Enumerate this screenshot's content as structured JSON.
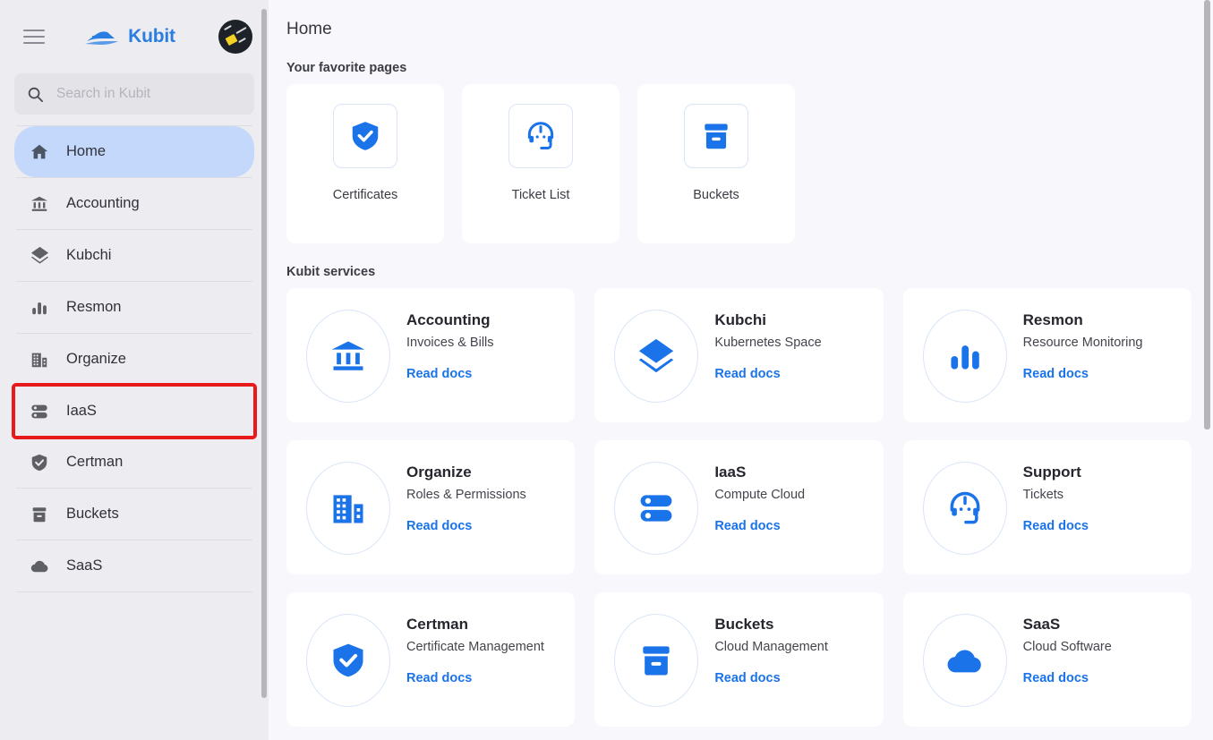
{
  "brand": {
    "name": "Kubit",
    "logo_icon": "speedboat-icon",
    "accent": "#2a7de1"
  },
  "sidebar": {
    "menu_icon": "hamburger-icon",
    "avatar_icon": "user-avatar",
    "search": {
      "placeholder": "Search in Kubit",
      "value": "",
      "icon": "search-icon"
    },
    "items": [
      {
        "label": "Home",
        "icon": "home-icon",
        "active": true,
        "highlighted": false
      },
      {
        "label": "Accounting",
        "icon": "bank-icon",
        "active": false,
        "highlighted": false
      },
      {
        "label": "Kubchi",
        "icon": "layers-icon",
        "active": false,
        "highlighted": false
      },
      {
        "label": "Resmon",
        "icon": "bar-chart-icon",
        "active": false,
        "highlighted": false
      },
      {
        "label": "Organize",
        "icon": "building-icon",
        "active": false,
        "highlighted": false
      },
      {
        "label": "IaaS",
        "icon": "server-icon",
        "active": false,
        "highlighted": true
      },
      {
        "label": "Certman",
        "icon": "shield-check-icon",
        "active": false,
        "highlighted": false
      },
      {
        "label": "Buckets",
        "icon": "archive-icon",
        "active": false,
        "highlighted": false
      },
      {
        "label": "SaaS",
        "icon": "cloud-icon",
        "active": false,
        "highlighted": false
      }
    ],
    "highlight_color": "#e8191b"
  },
  "main": {
    "page_title": "Home",
    "favorites_label": "Your favorite pages",
    "favorites": [
      {
        "name": "Certificates",
        "icon": "shield-check-icon"
      },
      {
        "name": "Ticket List",
        "icon": "headset-icon"
      },
      {
        "name": "Buckets",
        "icon": "archive-icon"
      }
    ],
    "services_label": "Kubit services",
    "read_docs_label": "Read docs",
    "services": [
      {
        "title": "Accounting",
        "subtitle": "Invoices & Bills",
        "icon": "bank-icon"
      },
      {
        "title": "Kubchi",
        "subtitle": "Kubernetes Space",
        "icon": "layers-icon"
      },
      {
        "title": "Resmon",
        "subtitle": "Resource Monitoring",
        "icon": "bar-chart-icon"
      },
      {
        "title": "Organize",
        "subtitle": "Roles & Permissions",
        "icon": "building-icon"
      },
      {
        "title": "IaaS",
        "subtitle": "Compute Cloud",
        "icon": "server-icon"
      },
      {
        "title": "Support",
        "subtitle": "Tickets",
        "icon": "headset-icon"
      },
      {
        "title": "Certman",
        "subtitle": "Certificate Management",
        "icon": "shield-check-icon"
      },
      {
        "title": "Buckets",
        "subtitle": "Cloud Management",
        "icon": "archive-icon"
      },
      {
        "title": "SaaS",
        "subtitle": "Cloud Software",
        "icon": "cloud-icon"
      }
    ]
  }
}
